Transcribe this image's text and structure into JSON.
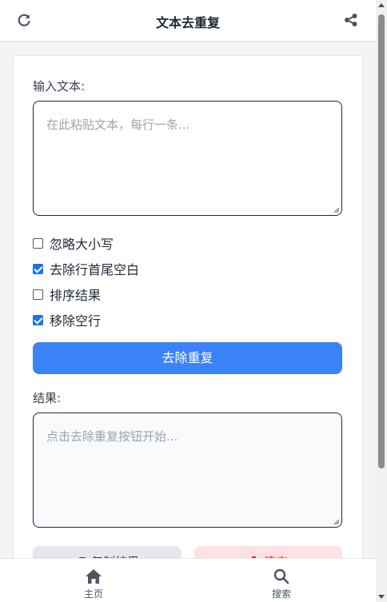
{
  "header": {
    "title": "文本去重复",
    "refresh_icon": "refresh-icon",
    "share_icon": "share-icon"
  },
  "input": {
    "label": "输入文本:",
    "placeholder": "在此粘贴文本，每行一条..."
  },
  "options": [
    {
      "label": "忽略大小写",
      "checked": false
    },
    {
      "label": "去除行首尾空白",
      "checked": true
    },
    {
      "label": "排序结果",
      "checked": false
    },
    {
      "label": "移除空行",
      "checked": true
    }
  ],
  "actions": {
    "dedupe_label": "去除重复",
    "copy_label": "复制结果",
    "clear_label": "清空"
  },
  "result": {
    "label": "结果:",
    "placeholder": "点击去除重复按钮开始..."
  },
  "nav": {
    "home_label": "主页",
    "search_label": "搜索"
  },
  "colors": {
    "primary": "#3b82f6",
    "danger": "#dc2626",
    "danger_bg": "#fee2e2"
  }
}
